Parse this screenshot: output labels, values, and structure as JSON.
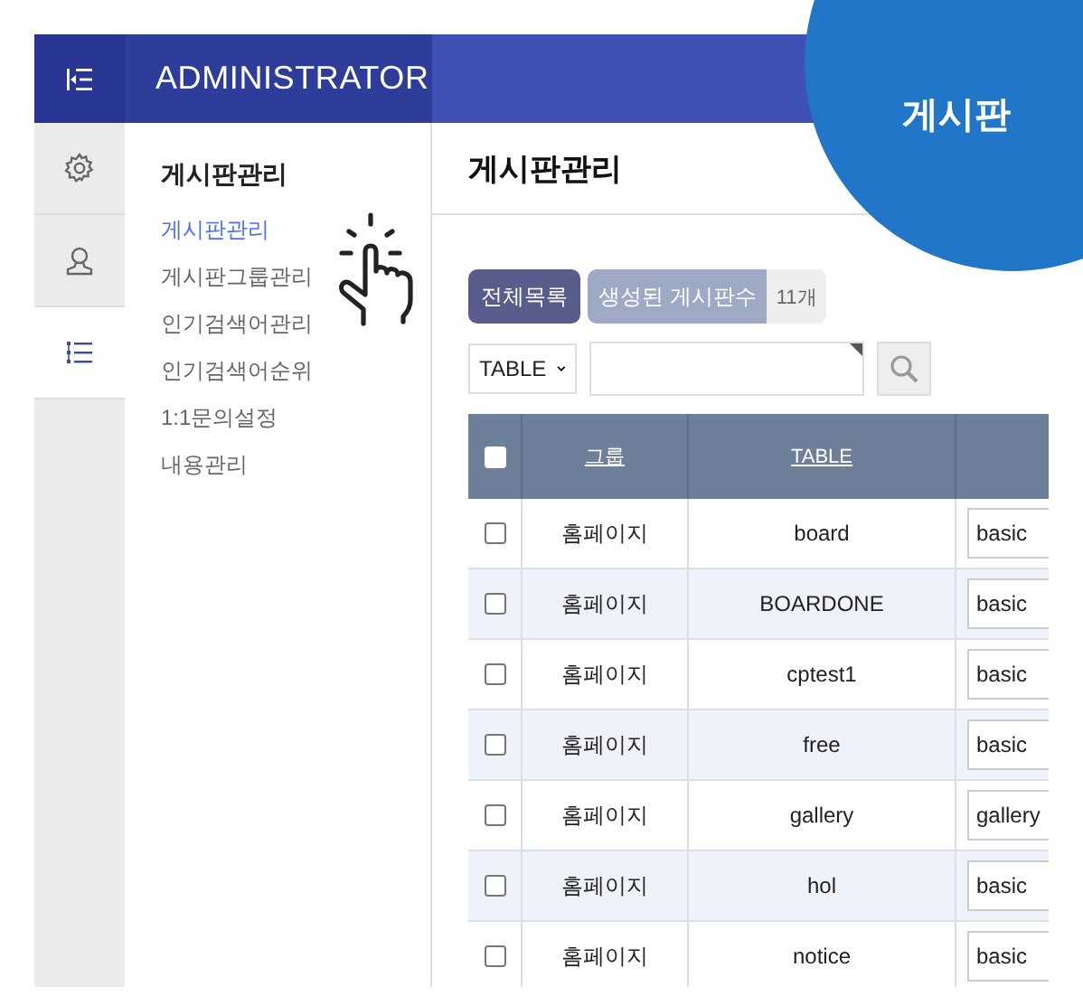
{
  "top_bar": {
    "title": "ADMINISTRATOR"
  },
  "icon_rail": [
    {
      "kind": "gear",
      "selected": false
    },
    {
      "kind": "user",
      "selected": false
    },
    {
      "kind": "list",
      "selected": true
    }
  ],
  "menu": {
    "heading": "게시판관리",
    "items": [
      {
        "label": "게시판관리",
        "selected": true
      },
      {
        "label": "게시판그룹관리",
        "selected": false
      },
      {
        "label": "인기검색어관리",
        "selected": false
      },
      {
        "label": "인기검색어순위",
        "selected": false
      },
      {
        "label": "1:1문의설정",
        "selected": false
      },
      {
        "label": "내용관리",
        "selected": false
      }
    ]
  },
  "page_title": "게시판관리",
  "list_button": "전체목록",
  "board_count": {
    "label": "생성된 게시판수",
    "value": "11개"
  },
  "search": {
    "field_select": "TABLE"
  },
  "table": {
    "select_all": false,
    "columns": [
      "그룹",
      "TABLE"
    ],
    "rows": [
      {
        "checked": false,
        "group": "홈페이지",
        "table": "board",
        "skin": "basic"
      },
      {
        "checked": false,
        "group": "홈페이지",
        "table": "BOARDONE",
        "skin": "basic"
      },
      {
        "checked": false,
        "group": "홈페이지",
        "table": "cptest1",
        "skin": "basic"
      },
      {
        "checked": false,
        "group": "홈페이지",
        "table": "free",
        "skin": "basic"
      },
      {
        "checked": false,
        "group": "홈페이지",
        "table": "gallery",
        "skin": "gallery"
      },
      {
        "checked": false,
        "group": "홈페이지",
        "table": "hol",
        "skin": "basic"
      },
      {
        "checked": false,
        "group": "홈페이지",
        "table": "notice",
        "skin": "basic"
      }
    ]
  },
  "corner_badge": "게시판"
}
